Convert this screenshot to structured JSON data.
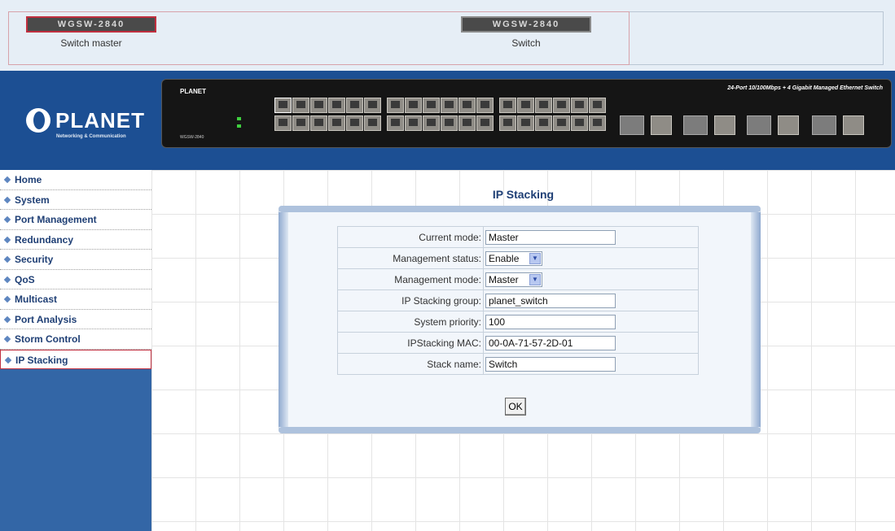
{
  "stack_bar": {
    "master": {
      "model": "WGSW-2840",
      "role": "Switch master"
    },
    "slave": {
      "model": "WGSW-2840",
      "role": "Switch"
    }
  },
  "header": {
    "logo_text": "PLANET",
    "logo_tagline": "Networking & Communication",
    "panel_brand": "PLANET",
    "panel_model": "WGSW-2840",
    "panel_description": "24-Port 10/100Mbps + 4 Gigabit Managed Ethernet Switch"
  },
  "sidebar": {
    "items": [
      {
        "label": "Home",
        "active": false
      },
      {
        "label": "System",
        "active": false
      },
      {
        "label": "Port Management",
        "active": false
      },
      {
        "label": "Redundancy",
        "active": false
      },
      {
        "label": "Security",
        "active": false
      },
      {
        "label": "QoS",
        "active": false
      },
      {
        "label": "Multicast",
        "active": false
      },
      {
        "label": "Port Analysis",
        "active": false
      },
      {
        "label": "Storm Control",
        "active": false
      },
      {
        "label": "IP Stacking",
        "active": true
      }
    ]
  },
  "main": {
    "title": "IP Stacking",
    "form": {
      "current_mode": {
        "label": "Current mode:",
        "value": "Master"
      },
      "management_status": {
        "label": "Management status:",
        "value": "Enable"
      },
      "management_mode": {
        "label": "Management mode:",
        "value": "Master"
      },
      "stacking_group": {
        "label": "IP Stacking group:",
        "value": "planet_switch"
      },
      "system_priority": {
        "label": "System priority:",
        "value": "100"
      },
      "stacking_mac": {
        "label": "IPStacking MAC:",
        "value": "00-0A-71-57-2D-01"
      },
      "stack_name": {
        "label": "Stack name:",
        "value": "Switch"
      }
    },
    "ok_label": "OK"
  },
  "colors": {
    "header_bg": "#1c4f93",
    "sidebar_bg": "#3366a6",
    "menu_text": "#1f3f75",
    "active_outline": "#c03040"
  }
}
